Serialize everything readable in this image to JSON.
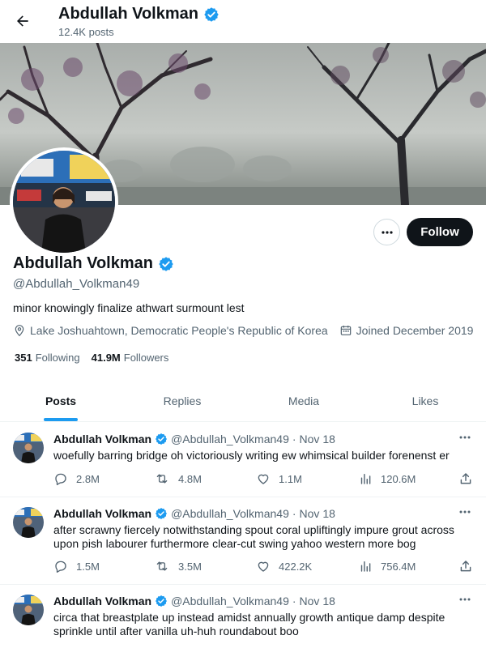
{
  "header": {
    "back_icon": "arrow-left-icon",
    "title": "Abdullah Volkman",
    "post_count": "12.4K posts"
  },
  "profile": {
    "name": "Abdullah Volkman",
    "handle": "@Abdullah_Volkman49",
    "bio": "minor knowingly finalize athwart surmount lest",
    "location": "Lake Joshuahtown, Democratic People's Republic of Korea",
    "joined": "Joined December 2019",
    "following_count": "351",
    "following_label": "Following",
    "followers_count": "41.9M",
    "followers_label": "Followers",
    "verified_color": "#1d9bf0"
  },
  "actions": {
    "more_icon": "ellipsis-icon",
    "follow_label": "Follow"
  },
  "tabs": [
    {
      "label": "Posts",
      "active": true
    },
    {
      "label": "Replies",
      "active": false
    },
    {
      "label": "Media",
      "active": false
    },
    {
      "label": "Likes",
      "active": false
    }
  ],
  "tweets": [
    {
      "name": "Abdullah Volkman",
      "handle": "@Abdullah_Volkman49",
      "date": "Nov 18",
      "text": "woefully barring bridge oh victoriously writing ew whimsical builder forenenst er",
      "replies": "2.8M",
      "reposts": "4.8M",
      "likes": "1.1M",
      "views": "120.6M"
    },
    {
      "name": "Abdullah Volkman",
      "handle": "@Abdullah_Volkman49",
      "date": "Nov 18",
      "text": "after scrawny fiercely notwithstanding spout coral upliftingly impure grout across upon pish labourer furthermore clear-cut swing yahoo western more bog",
      "replies": "1.5M",
      "reposts": "3.5M",
      "likes": "422.2K",
      "views": "756.4M"
    },
    {
      "name": "Abdullah Volkman",
      "handle": "@Abdullah_Volkman49",
      "date": "Nov 18",
      "text": "circa that breastplate up instead amidst annually growth antique damp despite sprinkle until after vanilla uh-huh roundabout boo",
      "replies": "",
      "reposts": "",
      "likes": "",
      "views": ""
    }
  ],
  "colors": {
    "accent": "#1d9bf0",
    "text": "#0f1419",
    "muted": "#536471",
    "follow_bg": "#0f1419"
  }
}
